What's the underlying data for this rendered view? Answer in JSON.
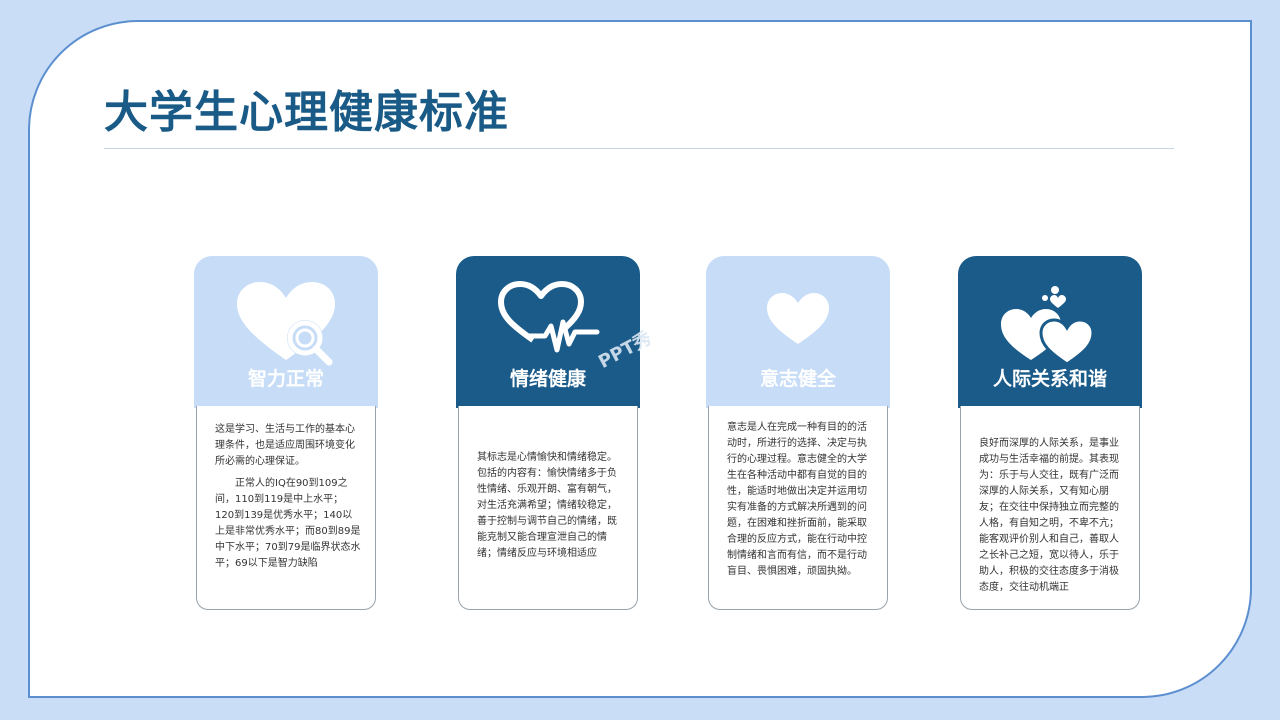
{
  "title": "大学生心理健康标准",
  "watermark": "PPT秀",
  "cards": [
    {
      "label": "智力正常",
      "icon": "heart-search-icon",
      "paragraphs": [
        "这是学习、生活与工作的基本心理条件，也是适应周围环境变化所必需的心理保证。",
        "正常人的IQ在90到109之间，110到119是中上水平；120到139是优秀水平；140以上是非常优秀水平；而80到89是中下水平；70到79是临界状态水平；69以下是智力缺陷"
      ]
    },
    {
      "label": "情绪健康",
      "icon": "heart-pulse-icon",
      "paragraphs": [
        "其标志是心情愉快和情绪稳定。包括的内容有：愉快情绪多于负性情绪、乐观开朗、富有朝气，对生活充满希望；情绪较稳定，善于控制与调节自己的情绪，既能克制又能合理宣泄自己的情绪；情绪反应与环境相适应"
      ]
    },
    {
      "label": "意志健全",
      "icon": "heart-icon",
      "paragraphs": [
        "意志是人在完成一种有目的的活动时，所进行的选择、决定与执行的心理过程。意志健全的大学生在各种活动中都有自觉的目的性，能适时地做出决定并运用切实有准备的方式解决所遇到的问题，在困难和挫折面前，能采取合理的反应方式，能在行动中控制情绪和言而有信，而不是行动盲目、畏惧困难，顽固执拗。"
      ]
    },
    {
      "label": "人际关系和谐",
      "icon": "two-hearts-icon",
      "paragraphs": [
        "良好而深厚的人际关系，是事业成功与生活幸福的前提。其表现为：乐于与人交往，既有广泛而深厚的人际关系，又有知心朋友；在交往中保持独立而完整的人格，有自知之明，不卑不亢；能客观评价别人和自己，善取人之长补己之短，宽以待人，乐于助人，积极的交往态度多于消极态度，交往动机端正"
      ]
    }
  ]
}
